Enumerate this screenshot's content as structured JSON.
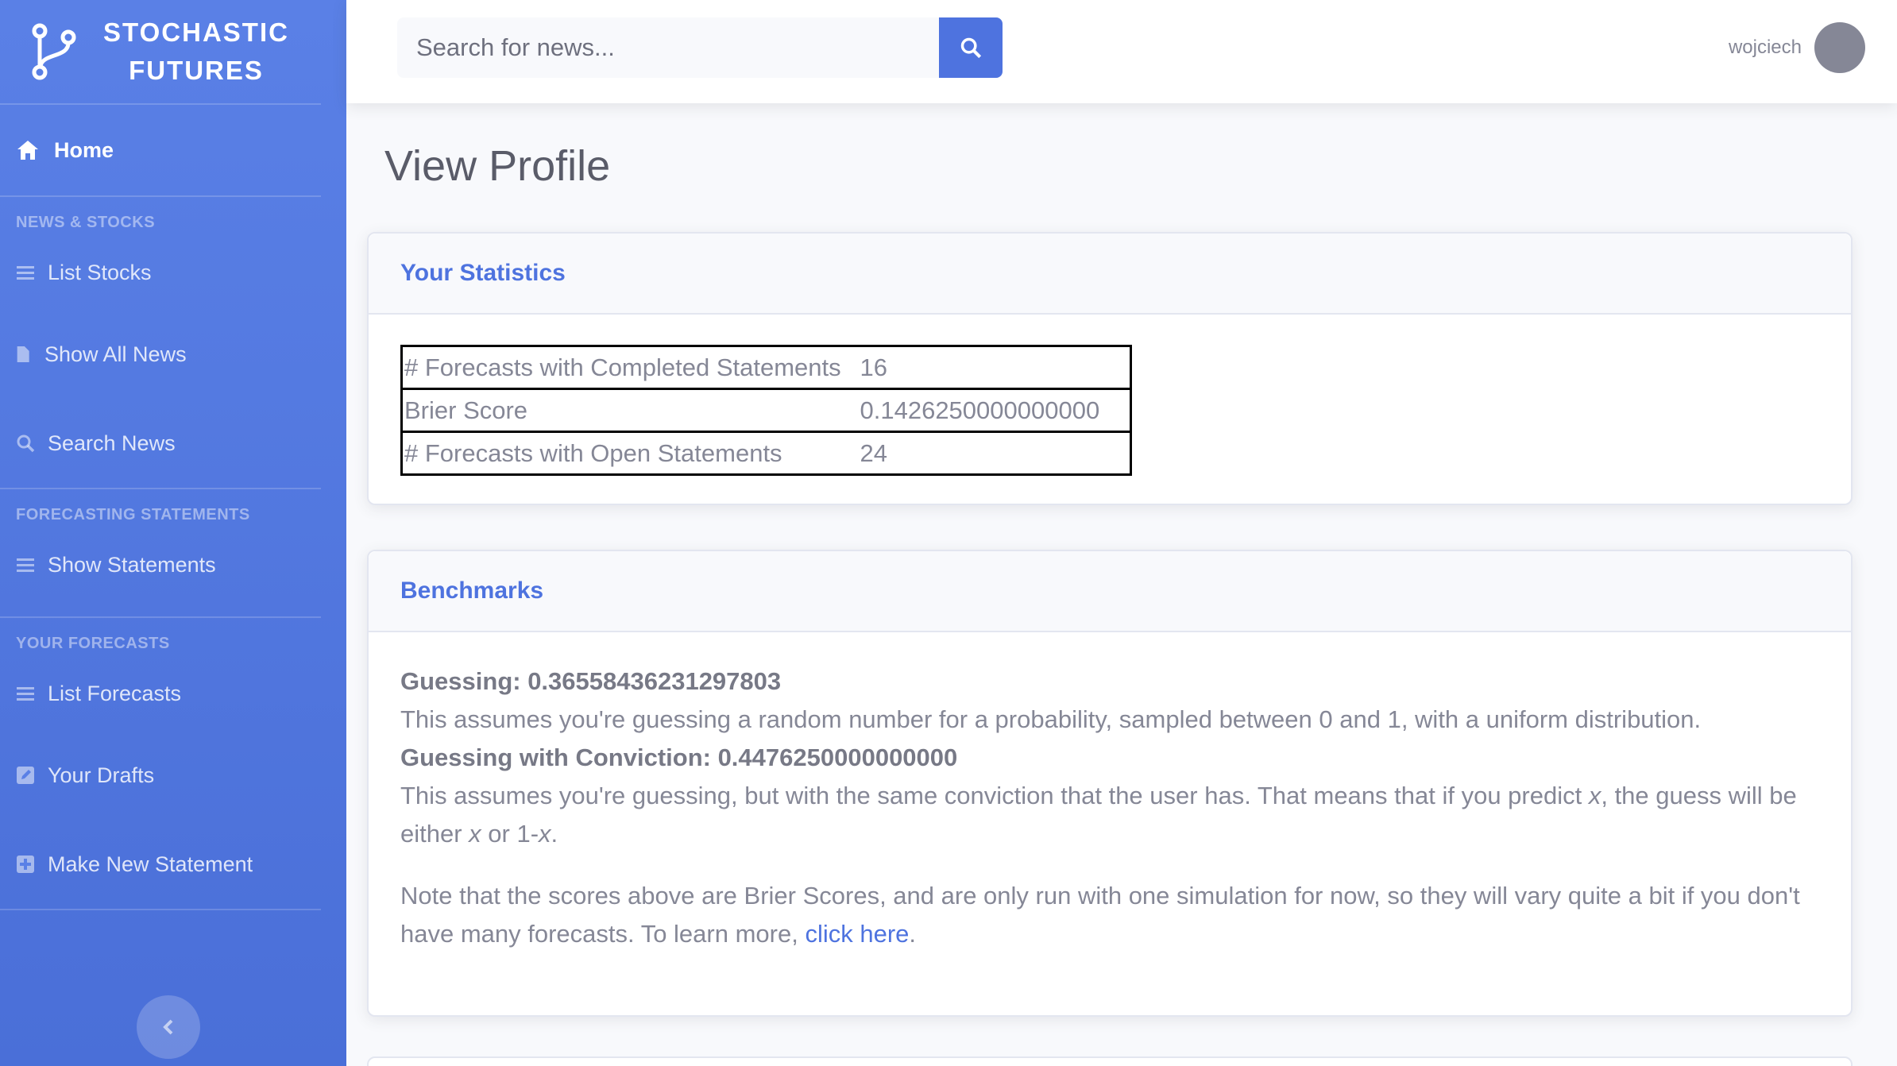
{
  "brand": {
    "line1": "STOCHASTIC",
    "line2": "FUTURES"
  },
  "sidebar": {
    "home": "Home",
    "sections": [
      {
        "heading": "NEWS & STOCKS",
        "items": [
          {
            "label": "List Stocks",
            "icon": "list-icon"
          },
          {
            "label": "Show All News",
            "icon": "file-icon"
          },
          {
            "label": "Search News",
            "icon": "search-icon"
          }
        ]
      },
      {
        "heading": "FORECASTING STATEMENTS",
        "items": [
          {
            "label": "Show Statements",
            "icon": "list-icon"
          }
        ]
      },
      {
        "heading": "YOUR FORECASTS",
        "items": [
          {
            "label": "List Forecasts",
            "icon": "list-icon"
          },
          {
            "label": "Your Drafts",
            "icon": "edit-icon"
          },
          {
            "label": "Make New Statement",
            "icon": "plus-square-icon"
          }
        ]
      }
    ],
    "toggle_icon": "chevron-left-icon"
  },
  "topbar": {
    "search_placeholder": "Search for news...",
    "username": "wojciech"
  },
  "page": {
    "title": "View Profile"
  },
  "statistics": {
    "heading": "Your Statistics",
    "rows": [
      {
        "key": "# Forecasts with Completed Statements",
        "value": "16"
      },
      {
        "key": "Brier Score",
        "value": "0.1426250000000000"
      },
      {
        "key": "# Forecasts with Open Statements",
        "value": "24"
      }
    ]
  },
  "benchmarks": {
    "heading": "Benchmarks",
    "guessing_label": "Guessing: 0.36558436231297803",
    "guessing_desc": "This assumes you're guessing a random number for a probability, sampled between 0 and 1, with a uniform distribution.",
    "conviction_label": "Guessing with Conviction: 0.4476250000000000",
    "conviction_desc_1": "This assumes you're guessing, but with the same conviction that the user has. That means that if you predict ",
    "conviction_x": "x",
    "conviction_desc_2": ", the guess will be either ",
    "conviction_x2": "x",
    "conviction_desc_3": " or 1-",
    "conviction_x3": "x",
    "conviction_desc_4": ".",
    "note_text": "Note that the scores above are Brier Scores, and are only run with one simulation for now, so they will vary quite a bit if you don't have many forecasts. To learn more, ",
    "note_link": "click here",
    "note_end": "."
  },
  "colors": {
    "primary": "#4e73df",
    "text": "#858796",
    "title": "#5a5c69"
  }
}
